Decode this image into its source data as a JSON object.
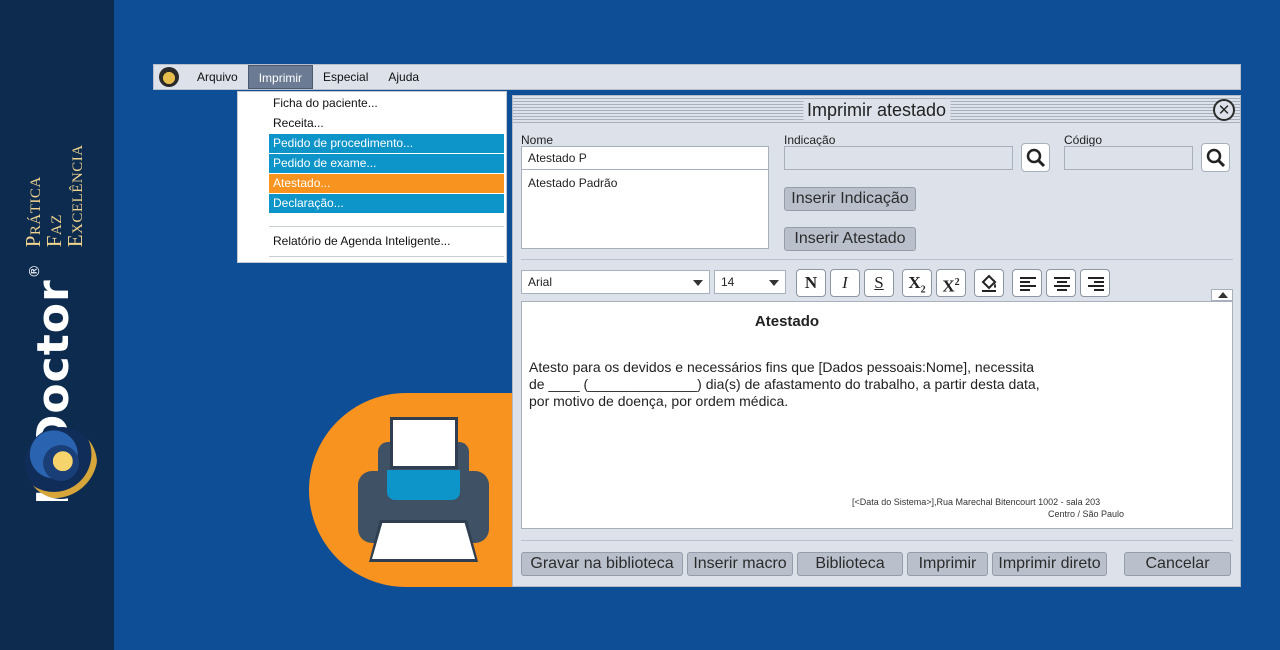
{
  "brand": {
    "name": "HiDoctor",
    "reg_mark": "®",
    "tagline": "Prática Faz Excelência"
  },
  "menubar": {
    "items": [
      "Arquivo",
      "Imprimir",
      "Especial",
      "Ajuda"
    ],
    "active": "Imprimir"
  },
  "dropdown": {
    "items": [
      {
        "label": "Ficha do paciente...",
        "style": "plain"
      },
      {
        "label": "Receita...",
        "style": "plain"
      },
      {
        "label": "Pedido de procedimento...",
        "style": "blue"
      },
      {
        "label": "Pedido de exame...",
        "style": "blue"
      },
      {
        "label": "Atestado...",
        "style": "orange"
      },
      {
        "label": "Declaração...",
        "style": "blue"
      },
      {
        "label": "Relatório de Agenda Inteligente...",
        "style": "plain"
      }
    ]
  },
  "dialog": {
    "title": "Imprimir atestado",
    "nome": {
      "label": "Nome",
      "value": "Atestado P",
      "list": [
        "Atestado Padrão"
      ]
    },
    "indicacao": {
      "label": "Indicação",
      "value": ""
    },
    "codigo": {
      "label": "Código",
      "value": ""
    },
    "buttons": {
      "inserir_indicacao": "Inserir Indicação",
      "inserir_atestado": "Inserir Atestado",
      "gravar": "Gravar na biblioteca",
      "macro": "Inserir macro",
      "biblioteca": "Biblioteca",
      "imprimir": "Imprimir",
      "imprimir_direto": "Imprimir direto",
      "cancelar": "Cancelar"
    },
    "toolbar": {
      "font": "Arial",
      "size": "14",
      "bold": "N",
      "italic": "I",
      "strike": "S",
      "subscript": "X",
      "subscript_mark": "2",
      "superscript": "X",
      "superscript_mark": "2"
    },
    "editor": {
      "heading": "Atestado",
      "lines": [
        "Atesto para os devidos e necessários fins que [Dados pessoais:Nome], necessita",
        "de ____ (______________) dia(s) de afastamento do trabalho, a partir desta data,",
        "por motivo de doença, por ordem médica."
      ],
      "footer_line1": "[<Data do Sistema>],Rua Marechal Bitencourt 1002 - sala 203",
      "footer_line2": "Centro / São Paulo"
    }
  },
  "colors": {
    "background": "#0e4e96",
    "sidebar": "#0d2a4f",
    "accent_orange": "#f7931e",
    "accent_blue": "#0d94c8"
  }
}
